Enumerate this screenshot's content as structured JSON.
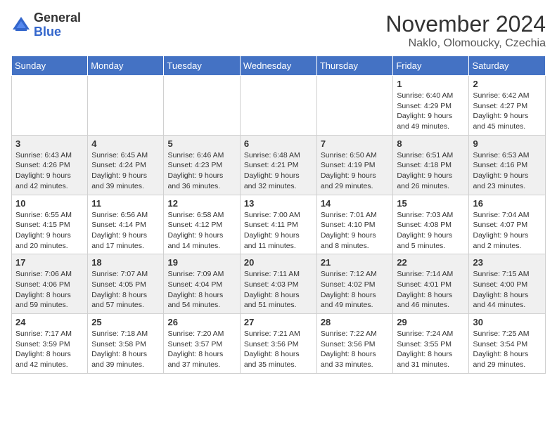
{
  "header": {
    "logo_general": "General",
    "logo_blue": "Blue",
    "month_title": "November 2024",
    "subtitle": "Naklo, Olomoucky, Czechia"
  },
  "days_of_week": [
    "Sunday",
    "Monday",
    "Tuesday",
    "Wednesday",
    "Thursday",
    "Friday",
    "Saturday"
  ],
  "weeks": [
    {
      "days": [
        {
          "num": "",
          "detail": ""
        },
        {
          "num": "",
          "detail": ""
        },
        {
          "num": "",
          "detail": ""
        },
        {
          "num": "",
          "detail": ""
        },
        {
          "num": "",
          "detail": ""
        },
        {
          "num": "1",
          "detail": "Sunrise: 6:40 AM\nSunset: 4:29 PM\nDaylight: 9 hours\nand 49 minutes."
        },
        {
          "num": "2",
          "detail": "Sunrise: 6:42 AM\nSunset: 4:27 PM\nDaylight: 9 hours\nand 45 minutes."
        }
      ]
    },
    {
      "days": [
        {
          "num": "3",
          "detail": "Sunrise: 6:43 AM\nSunset: 4:26 PM\nDaylight: 9 hours\nand 42 minutes."
        },
        {
          "num": "4",
          "detail": "Sunrise: 6:45 AM\nSunset: 4:24 PM\nDaylight: 9 hours\nand 39 minutes."
        },
        {
          "num": "5",
          "detail": "Sunrise: 6:46 AM\nSunset: 4:23 PM\nDaylight: 9 hours\nand 36 minutes."
        },
        {
          "num": "6",
          "detail": "Sunrise: 6:48 AM\nSunset: 4:21 PM\nDaylight: 9 hours\nand 32 minutes."
        },
        {
          "num": "7",
          "detail": "Sunrise: 6:50 AM\nSunset: 4:19 PM\nDaylight: 9 hours\nand 29 minutes."
        },
        {
          "num": "8",
          "detail": "Sunrise: 6:51 AM\nSunset: 4:18 PM\nDaylight: 9 hours\nand 26 minutes."
        },
        {
          "num": "9",
          "detail": "Sunrise: 6:53 AM\nSunset: 4:16 PM\nDaylight: 9 hours\nand 23 minutes."
        }
      ]
    },
    {
      "days": [
        {
          "num": "10",
          "detail": "Sunrise: 6:55 AM\nSunset: 4:15 PM\nDaylight: 9 hours\nand 20 minutes."
        },
        {
          "num": "11",
          "detail": "Sunrise: 6:56 AM\nSunset: 4:14 PM\nDaylight: 9 hours\nand 17 minutes."
        },
        {
          "num": "12",
          "detail": "Sunrise: 6:58 AM\nSunset: 4:12 PM\nDaylight: 9 hours\nand 14 minutes."
        },
        {
          "num": "13",
          "detail": "Sunrise: 7:00 AM\nSunset: 4:11 PM\nDaylight: 9 hours\nand 11 minutes."
        },
        {
          "num": "14",
          "detail": "Sunrise: 7:01 AM\nSunset: 4:10 PM\nDaylight: 9 hours\nand 8 minutes."
        },
        {
          "num": "15",
          "detail": "Sunrise: 7:03 AM\nSunset: 4:08 PM\nDaylight: 9 hours\nand 5 minutes."
        },
        {
          "num": "16",
          "detail": "Sunrise: 7:04 AM\nSunset: 4:07 PM\nDaylight: 9 hours\nand 2 minutes."
        }
      ]
    },
    {
      "days": [
        {
          "num": "17",
          "detail": "Sunrise: 7:06 AM\nSunset: 4:06 PM\nDaylight: 8 hours\nand 59 minutes."
        },
        {
          "num": "18",
          "detail": "Sunrise: 7:07 AM\nSunset: 4:05 PM\nDaylight: 8 hours\nand 57 minutes."
        },
        {
          "num": "19",
          "detail": "Sunrise: 7:09 AM\nSunset: 4:04 PM\nDaylight: 8 hours\nand 54 minutes."
        },
        {
          "num": "20",
          "detail": "Sunrise: 7:11 AM\nSunset: 4:03 PM\nDaylight: 8 hours\nand 51 minutes."
        },
        {
          "num": "21",
          "detail": "Sunrise: 7:12 AM\nSunset: 4:02 PM\nDaylight: 8 hours\nand 49 minutes."
        },
        {
          "num": "22",
          "detail": "Sunrise: 7:14 AM\nSunset: 4:01 PM\nDaylight: 8 hours\nand 46 minutes."
        },
        {
          "num": "23",
          "detail": "Sunrise: 7:15 AM\nSunset: 4:00 PM\nDaylight: 8 hours\nand 44 minutes."
        }
      ]
    },
    {
      "days": [
        {
          "num": "24",
          "detail": "Sunrise: 7:17 AM\nSunset: 3:59 PM\nDaylight: 8 hours\nand 42 minutes."
        },
        {
          "num": "25",
          "detail": "Sunrise: 7:18 AM\nSunset: 3:58 PM\nDaylight: 8 hours\nand 39 minutes."
        },
        {
          "num": "26",
          "detail": "Sunrise: 7:20 AM\nSunset: 3:57 PM\nDaylight: 8 hours\nand 37 minutes."
        },
        {
          "num": "27",
          "detail": "Sunrise: 7:21 AM\nSunset: 3:56 PM\nDaylight: 8 hours\nand 35 minutes."
        },
        {
          "num": "28",
          "detail": "Sunrise: 7:22 AM\nSunset: 3:56 PM\nDaylight: 8 hours\nand 33 minutes."
        },
        {
          "num": "29",
          "detail": "Sunrise: 7:24 AM\nSunset: 3:55 PM\nDaylight: 8 hours\nand 31 minutes."
        },
        {
          "num": "30",
          "detail": "Sunrise: 7:25 AM\nSunset: 3:54 PM\nDaylight: 8 hours\nand 29 minutes."
        }
      ]
    }
  ]
}
